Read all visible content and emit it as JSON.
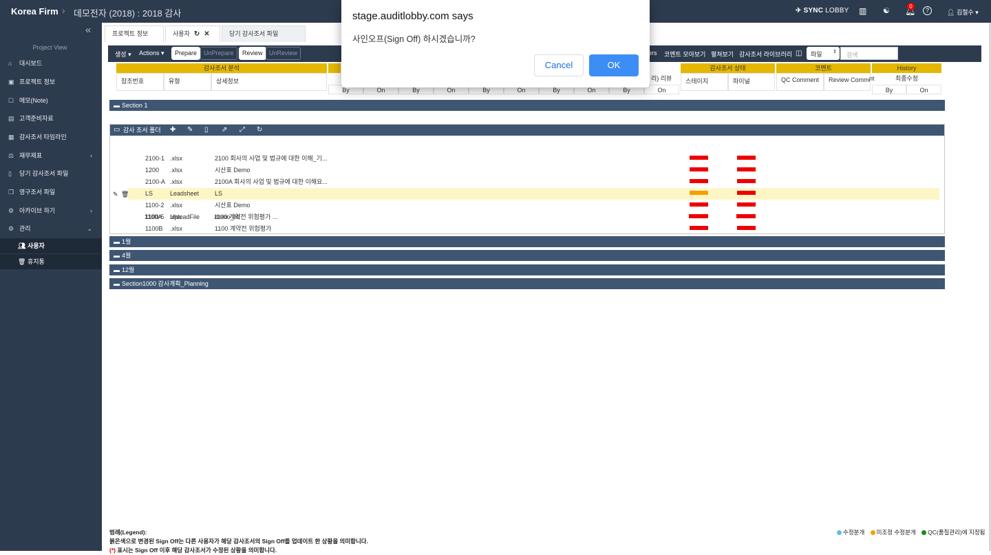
{
  "topbar": {
    "firm": "Korea Firm",
    "project": "데모전자 (2018) : 2018 감사",
    "sync_a": "SYNC",
    "sync_b": "LOBBY",
    "notif_count": "0",
    "user": "김철수"
  },
  "sidebar": {
    "section_label": "Project View",
    "items": [
      {
        "label": "대시보드",
        "icon": "home-icon"
      },
      {
        "label": "프로젝트 정보",
        "icon": "info-icon"
      },
      {
        "label": "메모(Note)",
        "icon": "note-icon"
      },
      {
        "label": "고객준비자료",
        "icon": "table-icon"
      },
      {
        "label": "감사조서 타임라인",
        "icon": "calendar-icon"
      },
      {
        "label": "재무제표",
        "icon": "finance-icon"
      },
      {
        "label": "당기 감사조서 파일",
        "icon": "file-icon"
      },
      {
        "label": "영구조서 파일",
        "icon": "copy-icon"
      },
      {
        "label": "아카이브 하기",
        "icon": "gear-icon"
      },
      {
        "label": "관리",
        "icon": "gear-icon"
      }
    ],
    "sub_items": [
      {
        "label": "사용자",
        "icon": "users-icon"
      },
      {
        "label": "휴지통",
        "icon": "trash-icon"
      }
    ]
  },
  "tabs": [
    {
      "label": "프로젝트 정보"
    },
    {
      "label": "사용자"
    },
    {
      "label": "당기 감사조서 파일"
    }
  ],
  "toolbar": {
    "create": "생성",
    "actions": "Actions",
    "prepare": "Prepare",
    "unprepare": "UnPrepare",
    "review": "Review",
    "unreview": "UnReview",
    "filters": "ers",
    "comments": "코멘트 모아보기",
    "expand": "펼쳐보기",
    "library": "감사조서 라이브러리",
    "file_select": "파일",
    "search_placeholder": "검색"
  },
  "columns": {
    "analysis": "감사조서 분석",
    "ref": "참조번호",
    "type": "유형",
    "detail": "상세정보",
    "review_tail": "리) 리뷰",
    "status": "감사조서 상태",
    "stage": "스테이지",
    "final": "파이널",
    "comment": "코멘트",
    "qc_comment": "QC Comment",
    "review_comment": "Review Comme",
    "review_comment_tail": "nt",
    "history": "History",
    "last_modified": "최종수정",
    "by": "By",
    "on": "On"
  },
  "sections": {
    "section1": "Section 1",
    "folder": "감사 조서 폴더",
    "jan": "1월",
    "apr": "4월",
    "dec": "12월",
    "planning": "Section1000 감사계획_Planning"
  },
  "rows": [
    {
      "ref": "2100-1",
      "type": ".xlsx",
      "desc": "2100 회사의 사업 및 법규에 대한 이해_기...",
      "stage": "red",
      "final": "red"
    },
    {
      "ref": "1200",
      "type": ".xlsx",
      "desc": "시산표 Demo",
      "stage": "red",
      "final": "red"
    },
    {
      "ref": "2100-A",
      "type": ".xlsx",
      "desc": "2100A 회사의 사업 및 법규에 대한 이해요...",
      "stage": "red",
      "final": "red"
    },
    {
      "ref": "LS",
      "type": "Leadsheet",
      "desc": "LS",
      "stage": "orange",
      "final": "red"
    },
    {
      "ref": "1100-2",
      "type": ".xlsx",
      "desc": "시산표 Demo",
      "stage": "red",
      "final": "red"
    },
    {
      "ref": "1100-5",
      "type": "UploadFile",
      "desc": "demo_lib",
      "stage": "red",
      "final": "red"
    },
    {
      "ref": "1100B",
      "type": ".xlsx",
      "desc": "1100 계약전 위험평가",
      "stage": "red",
      "final": "red"
    },
    {
      "ref": "1100A",
      "type": ".xlsx",
      "desc": "1100 계약전 위험평가 ...",
      "stage": "red",
      "final": "red"
    }
  ],
  "legend": {
    "title": "범례(Legend):",
    "line1": "붉은색으로 변경된 Sign Off는 다른 사용자가 해당 감사조서의 Sign Off를 업데이트 한 상황을 의미합니다.",
    "line2_mark": "(*)",
    "line2": " 표시는 Sign Off 이후 해당 감사조서가 수정된 상황을 의미합니다.",
    "modified": "수정분개",
    "unadjusted": "미조정 수정분개",
    "qc": "QC(품질관리)에 지정됨",
    "colors": {
      "modified": "#5bc0eb",
      "unadjusted": "#f6a000",
      "qc": "#1a8a1a"
    }
  },
  "dialog": {
    "title": "stage.auditlobby.com says",
    "message": "사인오프(Sign Off) 하시겠습니까?",
    "cancel": "Cancel",
    "ok": "OK"
  }
}
